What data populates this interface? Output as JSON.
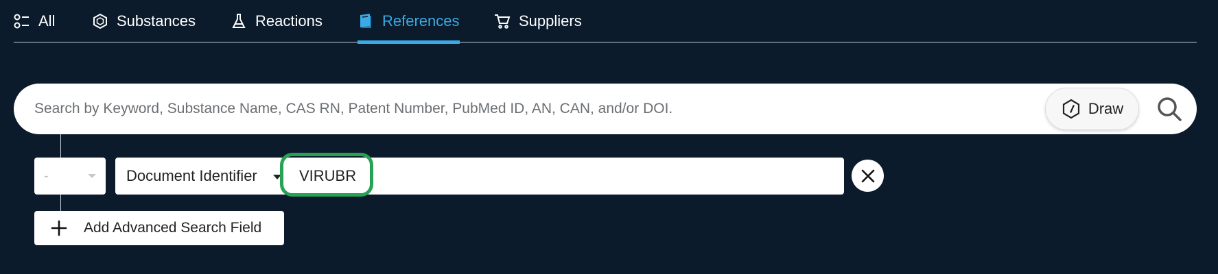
{
  "tabs": [
    {
      "label": "All",
      "icon": "filter-icon",
      "active": false
    },
    {
      "label": "Substances",
      "icon": "hexagon-icon",
      "active": false
    },
    {
      "label": "Reactions",
      "icon": "flask-icon",
      "active": false
    },
    {
      "label": "References",
      "icon": "book-icon",
      "active": true
    },
    {
      "label": "Suppliers",
      "icon": "cart-icon",
      "active": false
    }
  ],
  "search": {
    "placeholder": "Search by Keyword, Substance Name, CAS RN, Patent Number, PubMed ID, AN, CAN, and/or DOI.",
    "draw_label": "Draw"
  },
  "advanced": {
    "operator_value": "-",
    "field_label": "Document Identifier",
    "value": "VIRUBR",
    "add_label": "Add Advanced Search Field"
  },
  "colors": {
    "background": "#0b1b2b",
    "accent": "#3ba9e4",
    "highlight": "#27a155"
  }
}
